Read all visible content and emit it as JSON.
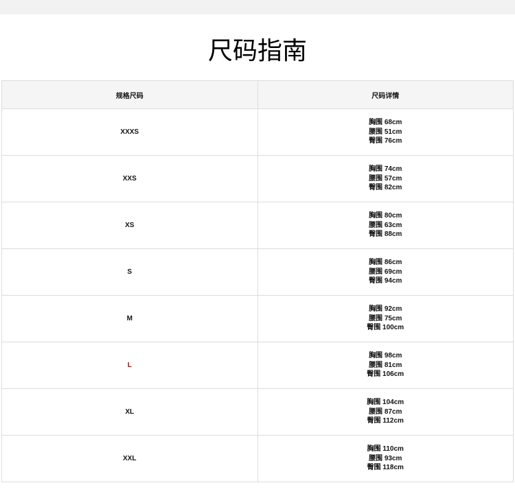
{
  "title": "尺码指南",
  "table": {
    "headers": [
      "规格尺码",
      "尺码详情"
    ],
    "rows": [
      {
        "size": "XXXS",
        "chest": "胸围 68cm",
        "waist": "腰围 51cm",
        "hip": "臀围 76cm"
      },
      {
        "size": "XXS",
        "chest": "胸围 74cm",
        "waist": "腰围 57cm",
        "hip": "臀围 82cm"
      },
      {
        "size": "XS",
        "chest": "胸围 80cm",
        "waist": "腰围 63cm",
        "hip": "臀围 88cm"
      },
      {
        "size": "S",
        "chest": "胸围 86cm",
        "waist": "腰围 69cm",
        "hip": "臀围 94cm"
      },
      {
        "size": "M",
        "chest": "胸围 92cm",
        "waist": "腰围 75cm",
        "hip": "臀围 100cm"
      },
      {
        "size": "L",
        "chest": "胸围 98cm",
        "waist": "腰围 81cm",
        "hip": "臀围 106cm"
      },
      {
        "size": "XL",
        "chest": "胸围 104cm",
        "waist": "腰围 87cm",
        "hip": "臀围 112cm"
      },
      {
        "size": "XXL",
        "chest": "胸围 110cm",
        "waist": "腰围 93cm",
        "hip": "臀围 118cm"
      }
    ]
  },
  "colors": {
    "highlight_size": "#8b1a10"
  }
}
